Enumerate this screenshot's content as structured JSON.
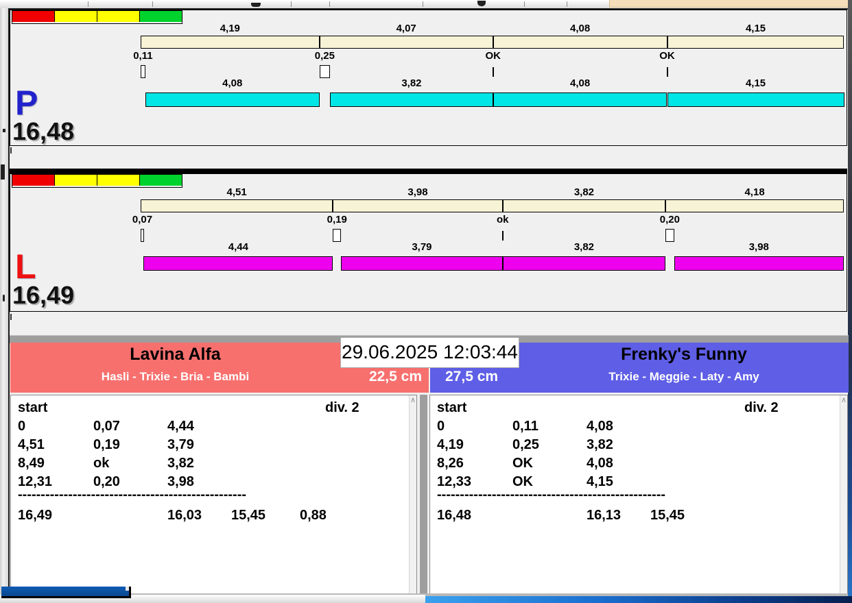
{
  "meta": {
    "datetime": "29.06.2025 12:03:44"
  },
  "icons": {
    "scroll_up": "∧"
  },
  "traffic_lights": [
    "#f00000",
    "#ffff00",
    "#ffff00",
    "#00d22d"
  ],
  "lanes": [
    {
      "letter": "P",
      "letter_color": "#2222cc",
      "bar_color": "#00e6e6",
      "total": "16,48",
      "splits": [
        "4,19",
        "4,07",
        "4,08",
        "4,15"
      ],
      "changeovers": [
        "0,11",
        "0,25",
        "OK",
        "OK"
      ],
      "runs": [
        "4,08",
        "3,82",
        "4,08",
        "4,15"
      ]
    },
    {
      "letter": "L",
      "letter_color": "#ee1111",
      "bar_color": "#ee00ee",
      "total": "16,49",
      "splits": [
        "4,51",
        "3,98",
        "3,82",
        "4,18"
      ],
      "changeovers": [
        "0,07",
        "0,19",
        "ok",
        "0,20"
      ],
      "runs": [
        "4,44",
        "3,79",
        "3,82",
        "3,98"
      ]
    }
  ],
  "teams": [
    {
      "name": "Lavina Alfa",
      "dogs": "Hasli - Trixie - Bria - Bambi",
      "height": "22,5 cm",
      "color": "#f7706e",
      "table": {
        "start_label": "start",
        "division_label": "div.  2",
        "rows": [
          [
            "0",
            "0,07",
            "4,44"
          ],
          [
            "4,51",
            "0,19",
            "3,79"
          ],
          [
            "8,49",
            "ok",
            "3,82"
          ],
          [
            "12,31",
            "0,20",
            "3,98"
          ]
        ],
        "separator": "--------------------------------------------------",
        "totals": [
          "16,49",
          "16,03",
          "15,45",
          "0,88"
        ]
      }
    },
    {
      "name": "Frenky's Funny",
      "dogs": "Trixie - Meggie - Laty - Amy",
      "height": "27,5 cm",
      "color": "#5e5ee6",
      "table": {
        "start_label": "start",
        "division_label": "div.  2",
        "rows": [
          [
            "0",
            "0,11",
            "4,08"
          ],
          [
            "4,19",
            "0,25",
            "3,82"
          ],
          [
            "8,26",
            "OK",
            "4,08"
          ],
          [
            "12,33",
            "OK",
            "4,15"
          ]
        ],
        "separator": "--------------------------------------------------",
        "totals": [
          "16,48",
          "16,13",
          "15,45"
        ]
      }
    }
  ]
}
